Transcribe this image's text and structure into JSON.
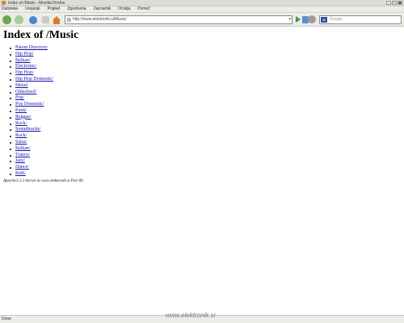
{
  "window": {
    "title": "Index of /Music - Mozilla Firefox",
    "minimize": "_",
    "maximize": "□",
    "close": "x"
  },
  "menubar": {
    "items": [
      "Datoteka",
      "Urejanje",
      "Pogled",
      "Zgodovina",
      "Zaznamki",
      "Orodja",
      "Pomoč"
    ]
  },
  "navbar": {
    "url": "http://www.elektronik.si/Music/",
    "search_placeholder": "Google",
    "search_engine_label": "G"
  },
  "page": {
    "title": "Index of /Music",
    "entries": [
      "Parent Directory",
      "Hip Hop/",
      "Balkan/",
      "Electronic/",
      "Hip Hop/",
      "Hip Hop Domestic/",
      "Metal/",
      "Oldschool/",
      "Pop/",
      "Pop Domestic/",
      "Punk/",
      "Reggae/",
      "Rock/",
      "Soundtracks/",
      "Rock/",
      "Salsa/",
      "Balkan/",
      "Trance/",
      "Jazz/",
      "Dance/",
      "RnB/"
    ],
    "signature": "Apache/2.2.3 Server at www.elektronik.si Port 80"
  },
  "statusbar": {
    "text": "Done"
  },
  "watermark": "www.elektronik.si"
}
